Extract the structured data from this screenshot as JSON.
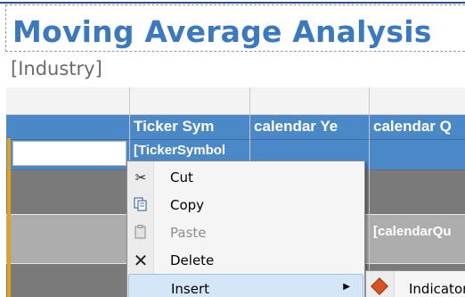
{
  "report": {
    "title": "Moving Average Analysis",
    "industry_param": "[Industry]"
  },
  "tablix": {
    "headers": [
      "Ticker Sym",
      "calendar Ye",
      "calendar Q"
    ],
    "row1_ticker": "[TickerSymbol",
    "row3_quarter": "[calendarQu"
  },
  "context_menu": {
    "items": [
      {
        "label": "Cut",
        "icon": "scissors-icon",
        "enabled": true
      },
      {
        "label": "Copy",
        "icon": "copy-icon",
        "enabled": true
      },
      {
        "label": "Paste",
        "icon": "paste-icon",
        "enabled": false
      },
      {
        "label": "Delete",
        "icon": "delete-x-icon",
        "enabled": true
      },
      {
        "label": "Insert",
        "icon": "",
        "enabled": true,
        "highlighted": true,
        "has_submenu": true
      }
    ]
  },
  "submenu": {
    "items": [
      {
        "label": "Indicator",
        "icon": "indicator-diamond-icon"
      }
    ]
  },
  "colors": {
    "title_blue": "#3a78bf",
    "header_blue": "#4b88c7",
    "band_dark_gray": "#7a7a7a",
    "band_light_gray": "#adadad",
    "selection_orange": "#e3a020"
  }
}
